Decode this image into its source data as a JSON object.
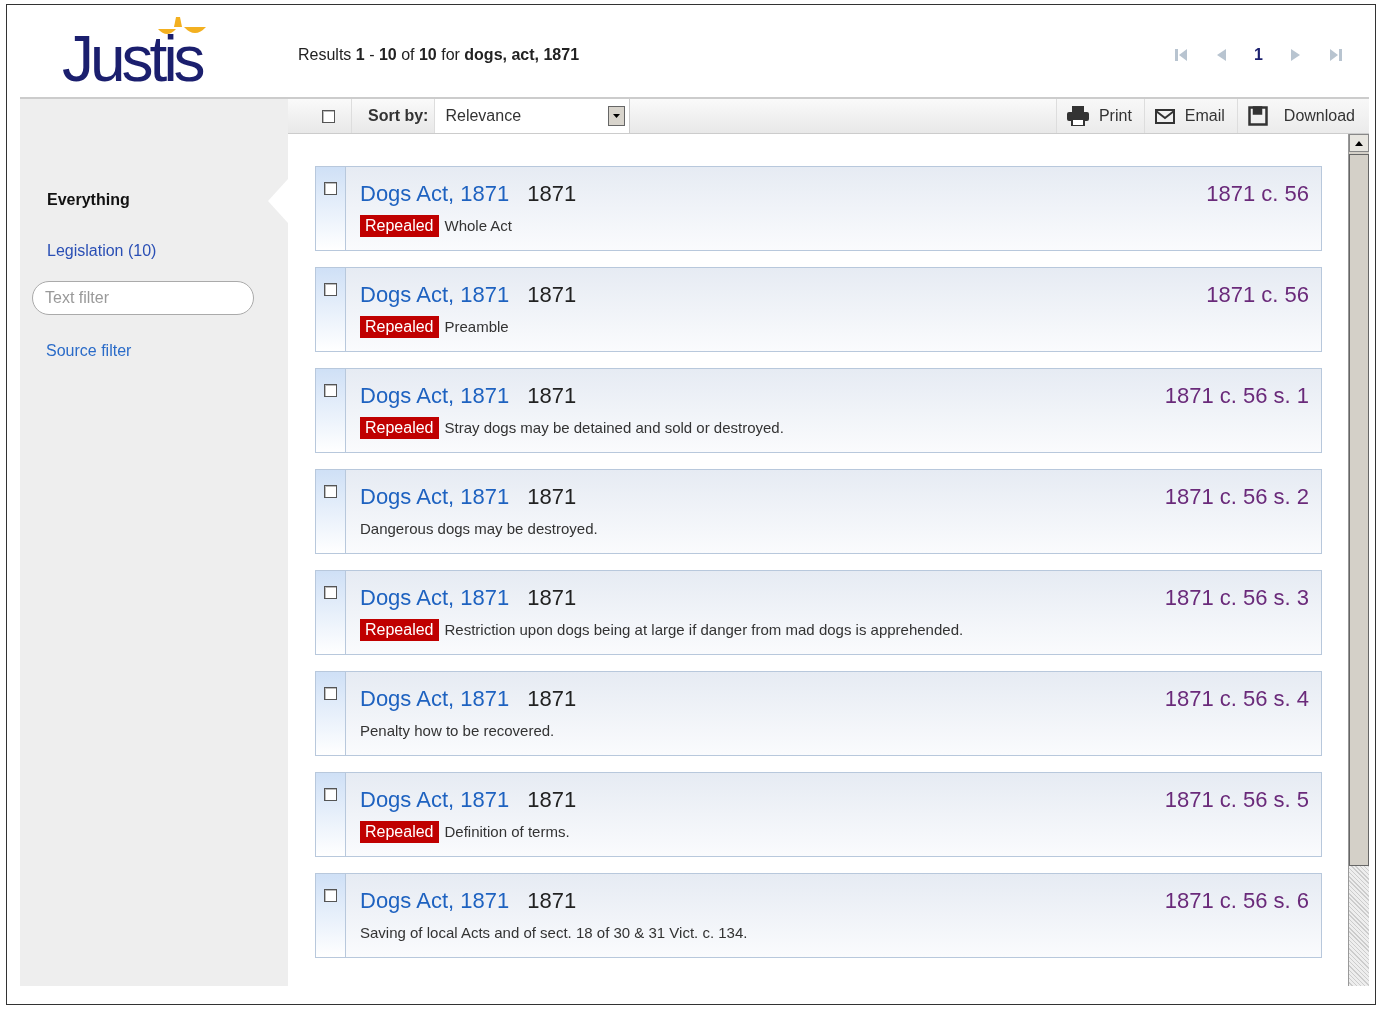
{
  "header": {
    "logo": "Justis",
    "results_summary": "Results **1** - **10** of **10** for  **dogs, act, 1871**",
    "pager": {
      "page": "1"
    }
  },
  "toolbar": {
    "select_all_checked": false,
    "sort_label": "Sort by:",
    "sort_value": "Relevance",
    "actions": [
      {
        "kind": "print",
        "label": "Print"
      },
      {
        "kind": "email",
        "label": "Email"
      },
      {
        "kind": "download",
        "label": "Download"
      }
    ]
  },
  "sidebar": {
    "items": [
      {
        "label": "Everything",
        "selected": true
      },
      {
        "label": "Legislation (10)",
        "selected": false
      }
    ],
    "text_filter": {
      "placeholder": "Text filter"
    },
    "source_filter": "Source filter"
  },
  "results": [
    {
      "title": "Dogs Act, 1871",
      "year": "1871",
      "citation": "1871 c. 56",
      "status": "Repealed",
      "description": "Whole Act",
      "checked": false
    },
    {
      "title": "Dogs Act, 1871",
      "year": "1871",
      "citation": "1871 c. 56",
      "status": "Repealed",
      "description": "Preamble",
      "checked": false
    },
    {
      "title": "Dogs Act, 1871",
      "year": "1871",
      "citation": "1871 c. 56 s. 1",
      "status": "Repealed",
      "description": "Stray dogs may be detained and sold or destroyed.",
      "checked": false
    },
    {
      "title": "Dogs Act, 1871",
      "year": "1871",
      "citation": "1871 c. 56 s. 2",
      "description": "Dangerous dogs may be destroyed.",
      "checked": false
    },
    {
      "title": "Dogs Act, 1871",
      "year": "1871",
      "citation": "1871 c. 56 s. 3",
      "status": "Repealed",
      "description": "Restriction upon dogs being at large if danger from mad dogs is apprehended.",
      "checked": false
    },
    {
      "title": "Dogs Act, 1871",
      "year": "1871",
      "citation": "1871 c. 56 s. 4",
      "description": "Penalty how to be recovered.",
      "checked": false
    },
    {
      "title": "Dogs Act, 1871",
      "year": "1871",
      "citation": "1871 c. 56 s. 5",
      "status": "Repealed",
      "description": "Definition of terms.",
      "checked": false
    },
    {
      "title": "Dogs Act, 1871",
      "year": "1871",
      "citation": "1871 c. 56 s. 6",
      "description": "Saving of local Acts and of sect. 18 of 30 & 31 Vict. c. 134.",
      "checked": false
    }
  ]
}
